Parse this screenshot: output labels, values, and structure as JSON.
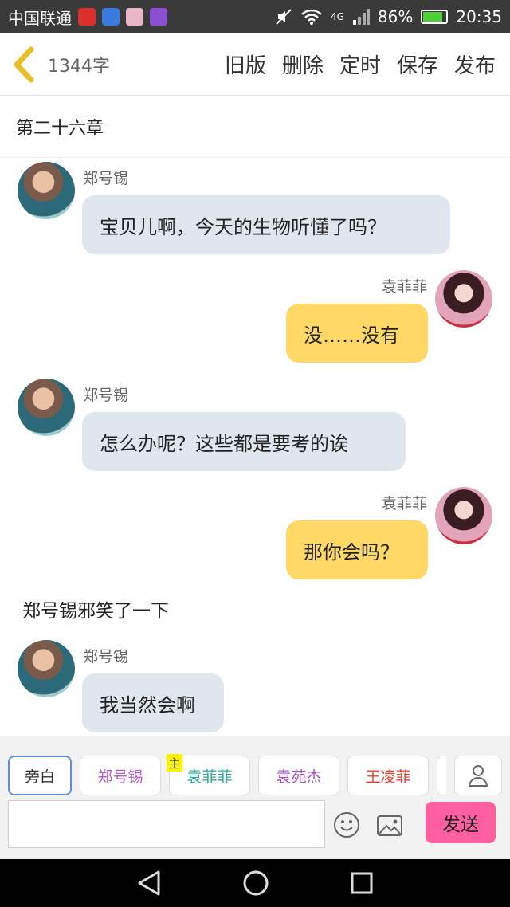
{
  "status_bar": {
    "carrier": "中国联通",
    "network": "4G",
    "battery": "86%",
    "time": "20:35",
    "battery_level": 0.86
  },
  "toolbar": {
    "word_count": "1344字",
    "actions": [
      "旧版",
      "删除",
      "定时",
      "保存",
      "发布"
    ]
  },
  "chapter_title": "第二十六章",
  "messages": [
    {
      "speaker": "郑号锡",
      "text": "宝贝儿啊，今天的生物听懂了吗？"
    },
    {
      "speaker": "袁菲菲",
      "text": "没……没有"
    },
    {
      "speaker": "郑号锡",
      "text": "怎么办呢？这些都是要考的诶"
    },
    {
      "speaker": "袁菲菲",
      "text": "那你会吗？"
    },
    {
      "narration": "郑号锡邪笑了一下"
    },
    {
      "speaker": "郑号锡",
      "text": "我当然会啊"
    }
  ],
  "roles": [
    {
      "label": "旁白",
      "color": "#333333"
    },
    {
      "label": "郑号锡",
      "color": "#b05bc7"
    },
    {
      "label": "袁菲菲",
      "color": "#2aa9a0",
      "badge": "主"
    },
    {
      "label": "袁苑杰",
      "color": "#a24fc0"
    },
    {
      "label": "王凌菲",
      "color": "#e5412f"
    }
  ],
  "composer": {
    "placeholder": "",
    "send_label": "发送"
  },
  "colors": {
    "left_bubble": "#e0e6ee",
    "right_bubble": "#ffd866",
    "send": "#ff5fa0",
    "back_arrow": "#e8c12a"
  }
}
